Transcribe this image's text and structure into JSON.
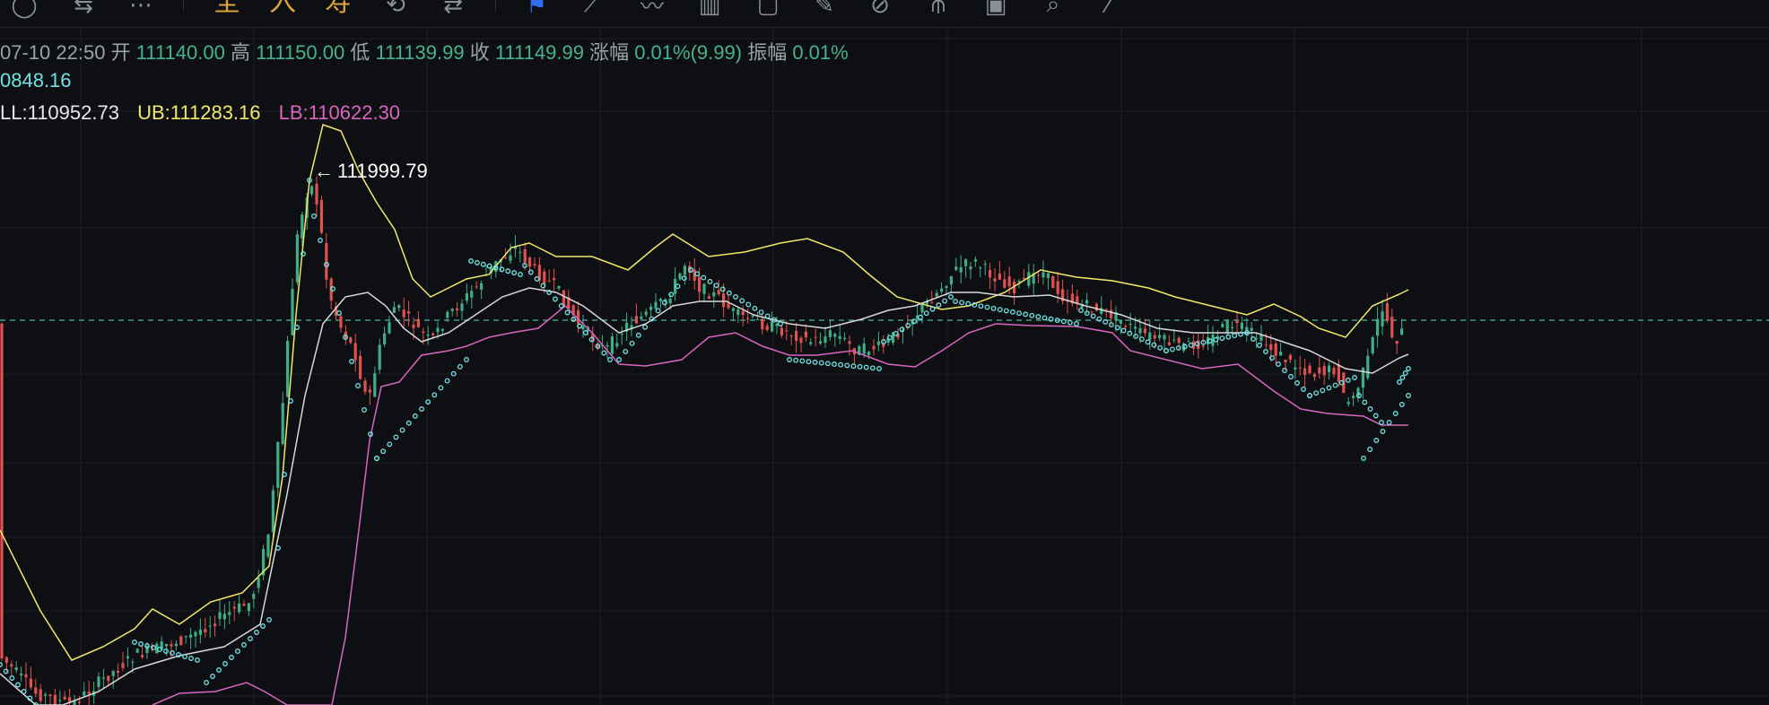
{
  "toolbar": {
    "icons": [
      "circle-icon",
      "indicator-settings-icon",
      "more-icon",
      "divider",
      "cn-all",
      "cn-in",
      "cn-hash",
      "replay-icon",
      "compare-icon",
      "divider",
      "bookmark-icon",
      "ruler-icon",
      "trend-icon",
      "candles-icon",
      "frame-icon",
      "edit-icon",
      "link-icon",
      "pitchfork-icon",
      "calendar-icon",
      "magnify-icon",
      "slash-icon"
    ],
    "cn_labels": [
      "全",
      "入",
      "寿"
    ]
  },
  "ohlc": {
    "time": "07-10 22:50",
    "open_label": "开",
    "open": "111140.00",
    "high_label": "高",
    "high": "111150.00",
    "low_label": "低",
    "low": "111139.99",
    "close_label": "收",
    "close": "111149.99",
    "change_label": "涨幅",
    "change": "0.01%(9.99)",
    "amp_label": "振幅",
    "amp": "0.01%"
  },
  "sar_line": {
    "value": "0848.16",
    "color": "#6fe3e6"
  },
  "boll": {
    "mid_label": "LL:",
    "mid": "110952.73",
    "mid_color": "#e8e8e8",
    "ub_label": "UB:",
    "ub": "111283.16",
    "ub_color": "#f2e86a",
    "lb_label": "LB:",
    "lb": "110622.30",
    "lb_color": "#d865c0"
  },
  "peak_note": "111999.79",
  "colors": {
    "up": "#3fae86",
    "down": "#e0524f",
    "ub": "#f2e86a",
    "mid": "#d8d8d8",
    "lb": "#d865c0",
    "sar": "#6fe3e6",
    "grid": "#1c1f25",
    "last": "#4fb8a0"
  },
  "chart_data": {
    "type": "candlestick",
    "last_price_line": true,
    "grid": true
  }
}
